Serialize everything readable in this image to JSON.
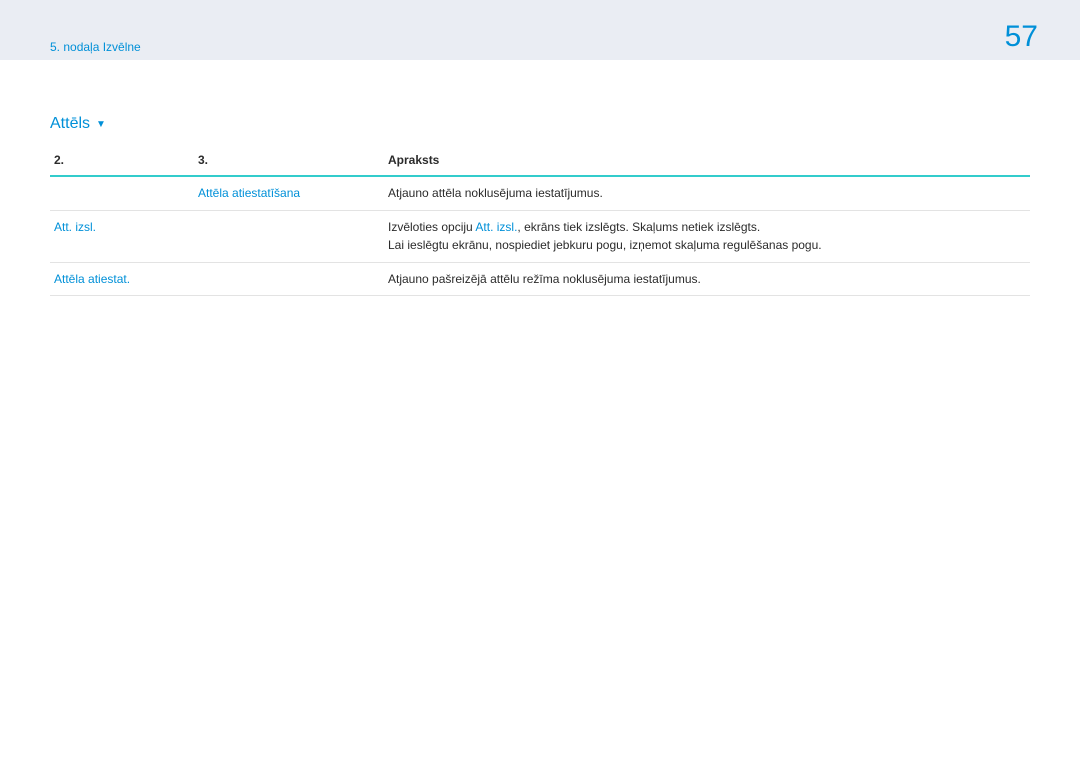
{
  "header": {
    "breadcrumb": "5. nodaļa Izvēlne",
    "page_number": "57"
  },
  "section": {
    "title": "Attēls"
  },
  "table": {
    "headers": {
      "c1": "2.",
      "c2": "3.",
      "c3": "Apraksts"
    },
    "rows": [
      {
        "c1": "",
        "c2": "Attēla atiestatīšana",
        "c3_plain": "Atjauno attēla noklusējuma iestatījumus."
      },
      {
        "c1": "Att. izsl.",
        "c2": "",
        "c3_pre": "Izvēloties opciju ",
        "c3_link": "Att. izsl.",
        "c3_post": ", ekrāns tiek izslēgts. Skaļums netiek izslēgts.",
        "c3_line2": "Lai ieslēgtu ekrānu, nospiediet jebkuru pogu, izņemot skaļuma regulēšanas pogu."
      },
      {
        "c1": "Attēla atiestat.",
        "c2": "",
        "c3_plain": "Atjauno pašreizējā attēlu režīma noklusējuma iestatījumus."
      }
    ]
  }
}
